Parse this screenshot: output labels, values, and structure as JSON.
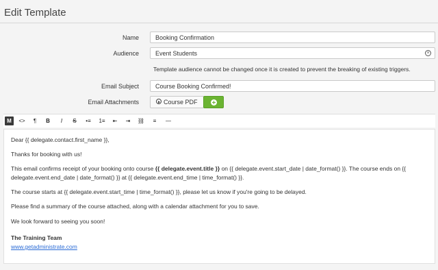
{
  "page": {
    "title": "Edit Template"
  },
  "form": {
    "name": {
      "label": "Name",
      "value": "Booking Confirmation"
    },
    "audience": {
      "label": "Audience",
      "value": "Event Students",
      "clear_icon": "close-circle-icon",
      "help": "Template audience cannot be changed once it is created to prevent the breaking of existing triggers."
    },
    "email_subject": {
      "label": "Email Subject",
      "value": "Course Booking Confirmed!"
    },
    "email_attachments": {
      "label": "Email Attachments",
      "attachment_label": "Course PDF",
      "add_button_color": "#6bb432"
    }
  },
  "toolbar": {
    "items": [
      "M",
      "<>",
      "¶",
      "B",
      "I",
      "S",
      "•≡",
      "1≡",
      "⇤",
      "⇥",
      "⛓",
      "≡",
      "—"
    ]
  },
  "editor": {
    "greeting": "Dear {{ delegate.contact.first_name }},",
    "thanks": "Thanks for booking with us!",
    "p1_a": "This email confirms receipt of your booking onto course ",
    "p1_bold": "{{ delegate.event.title }}",
    "p1_b": " on {{ delegate.event.start_date | date_format() }}. The course ends on {{",
    "p1_c": "delegate.event.end_date | date_format() }} at {{ delegate.event.end_time | time_format() }}.",
    "p2": "The course starts at {{ delegate.event.start_time | time_format() }}, please let us know if you're going to be delayed.",
    "p3": "Please find a summary of the course attached, along with a calendar attachment for you to save.",
    "p4": "We look forward to seeing you soon!",
    "signature": "The Training Team",
    "website": "www.getadministrate.com"
  }
}
